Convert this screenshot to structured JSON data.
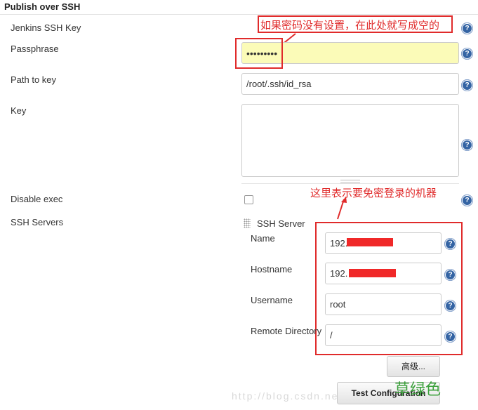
{
  "section": {
    "title": "Publish over SSH"
  },
  "fields": {
    "jenkins_ssh_key": {
      "label": "Jenkins SSH Key"
    },
    "passphrase": {
      "label": "Passphrase",
      "value": "•••••••••"
    },
    "path_to_key": {
      "label": "Path to key",
      "value": "/root/.ssh/id_rsa"
    },
    "key": {
      "label": "Key",
      "value": ""
    },
    "disable_exec": {
      "label": "Disable exec",
      "checked": false
    },
    "ssh_servers": {
      "label": "SSH Servers"
    }
  },
  "ssh_server": {
    "header": "SSH Server",
    "name": {
      "label": "Name",
      "value": "192."
    },
    "hostname": {
      "label": "Hostname",
      "value": "192."
    },
    "username": {
      "label": "Username",
      "value": "root"
    },
    "remote_directory": {
      "label": "Remote Directory",
      "value": "/"
    }
  },
  "buttons": {
    "advanced": "高级...",
    "test_configuration": "Test Configuration"
  },
  "annotations": {
    "passphrase_note": "如果密码没有设置，在此处就写成空的",
    "servers_note": "这里表示要免密登录的机器",
    "green_note": "草绿色"
  },
  "watermark": "http://blog.csdn.net/",
  "help_icon": "?",
  "colors": {
    "annotation_red": "#e02b2b",
    "redaction": "#f02828",
    "passphrase_bg": "#fbfbb8",
    "help_blue": "#3464a4",
    "green_note": "#3ca13c"
  }
}
